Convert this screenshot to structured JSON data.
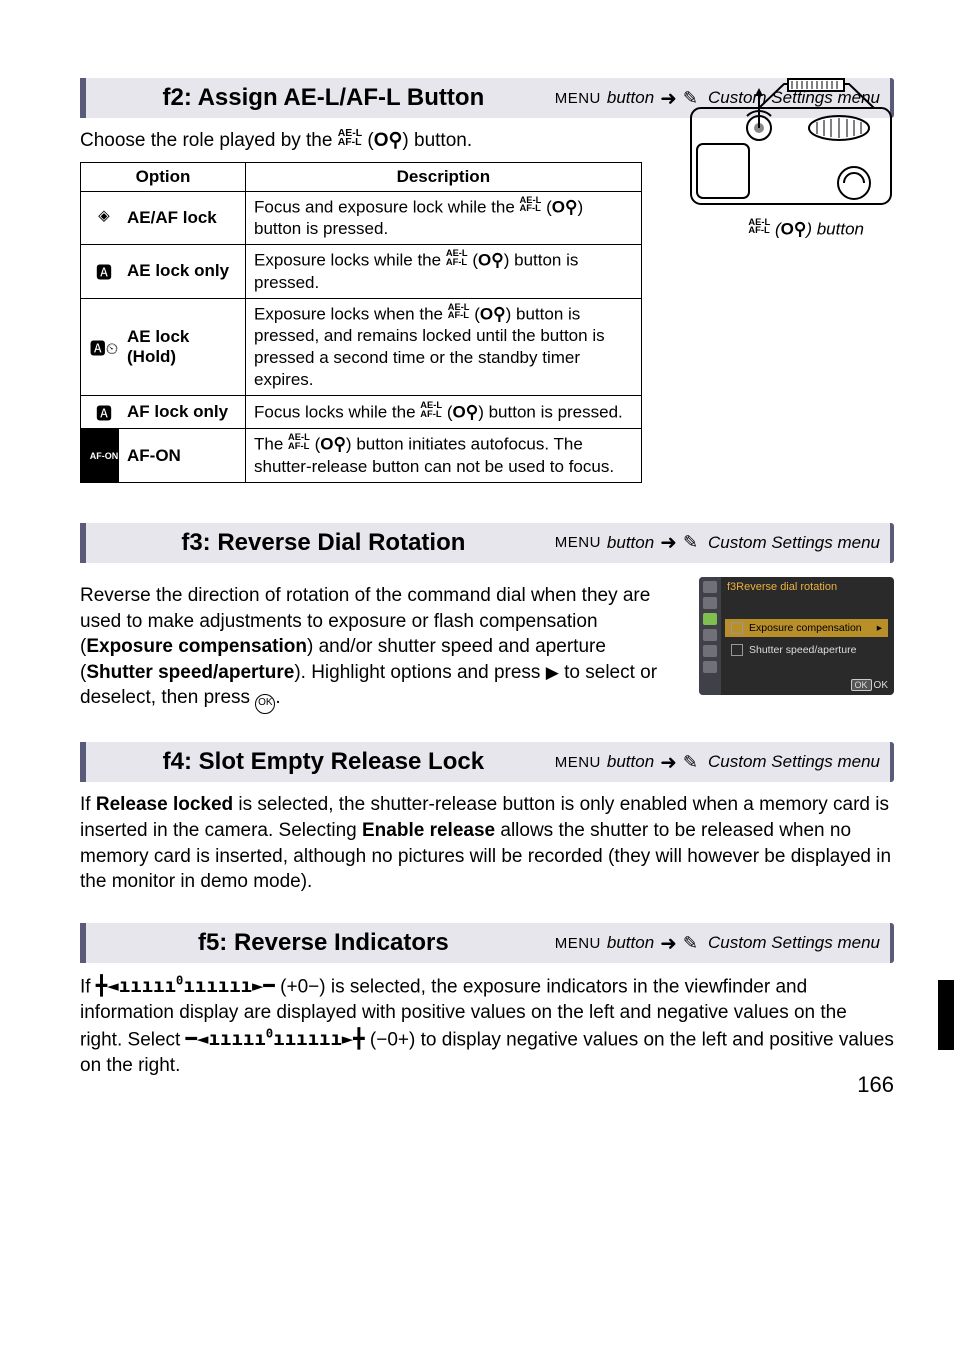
{
  "f2": {
    "title": "f2: Assign AE-L/AF-L Button",
    "crumb_menu": "MENU",
    "crumb_text": "button",
    "crumb_target": "Custom Settings menu",
    "intro_pre": "Choose the role played by the ",
    "intro_post": " button.",
    "table_head_option": "Option",
    "table_head_desc": "Description",
    "rows": [
      {
        "icon": "🔒",
        "name": "AE/AF lock",
        "desc_pre": "Focus and exposure lock while the ",
        "desc_post": " button is pressed."
      },
      {
        "icon": "🅰",
        "name": "AE lock only",
        "desc_pre": "Exposure locks while the ",
        "desc_post": " button is pressed."
      },
      {
        "icon": "🅰⏱",
        "name": "AE lock (Hold)",
        "desc_pre": "Exposure locks when the ",
        "desc_mid": " button is pressed, and remains locked until the button is pressed a second time or the standby timer expires.",
        "desc_post": ""
      },
      {
        "icon": "🅰",
        "name": "AF lock only",
        "desc_pre": "Focus locks while the ",
        "desc_post": " button is pressed."
      },
      {
        "icon": "AF-ON",
        "name": "AF-ON",
        "desc_pre": "The ",
        "desc_post": " button initiates autofocus.  The shutter-release button can not be used to focus."
      }
    ],
    "cam_label": " button"
  },
  "f3": {
    "title": "f3: Reverse Dial Rotation",
    "crumb_menu": "MENU",
    "crumb_text": "button",
    "crumb_target": "Custom Settings menu",
    "body_a": "Reverse the direction of rotation of the command dial when they are used to make adjustments to exposure or flash compensation (",
    "bold_a": "Exposure compensation",
    "body_b": ") and/or shutter speed and aperture (",
    "bold_b": "Shutter speed/aperture",
    "body_c": ").  Highlight options and press ",
    "body_d": " to select or deselect, then press ",
    "body_e": ".",
    "menu_title": "f3Reverse dial rotation",
    "menu_row1": "Exposure compensation",
    "menu_row2": "Shutter speed/aperture",
    "menu_ok": "OK"
  },
  "f4": {
    "title": "f4: Slot Empty Release Lock",
    "crumb_menu": "MENU",
    "crumb_text": "button",
    "crumb_target": "Custom Settings menu",
    "body_a": "If ",
    "bold_a": "Release locked",
    "body_b": " is selected, the shutter-release button is only enabled when a memory card is inserted in the camera.  Selecting ",
    "bold_b": "Enable release",
    "body_c": " allows the shutter to be released when no memory card is inserted, although no pictures will be recorded (they will however be displayed in the monitor in demo mode)."
  },
  "f5": {
    "title": "f5: Reverse Indicators",
    "crumb_menu": "MENU",
    "crumb_text": "button",
    "crumb_target": "Custom Settings menu",
    "body_a": "If ",
    "code_a": "+0−",
    "body_b": " is selected, the exposure indicators in the viewfinder and information display are displayed with positive values on the left and negative values on the right.  Select ",
    "code_b": "−0+",
    "body_c": " to display negative values on the left and positive values on the right."
  },
  "page_number": "166"
}
